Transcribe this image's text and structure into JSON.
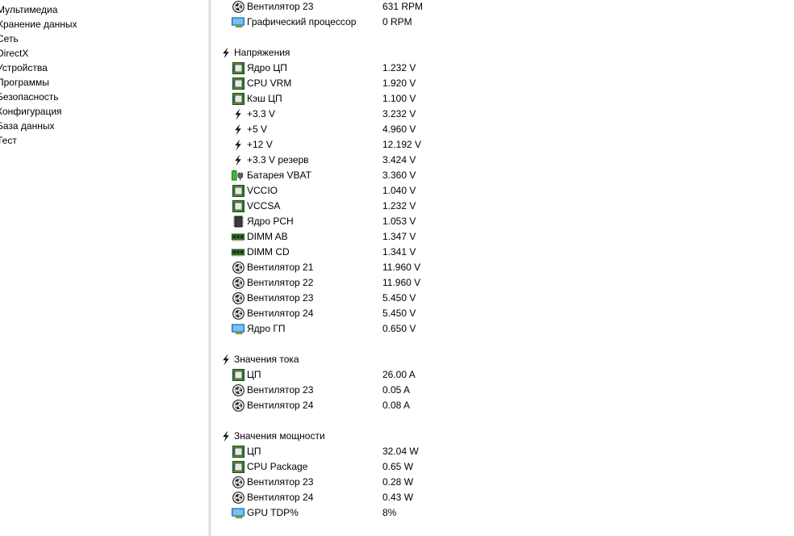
{
  "sidebar": {
    "items": [
      {
        "label": "Мультимедиа"
      },
      {
        "label": "Хранение данных"
      },
      {
        "label": "Сеть"
      },
      {
        "label": "DirectX"
      },
      {
        "label": "Устройства"
      },
      {
        "label": "Программы"
      },
      {
        "label": "Безопасность"
      },
      {
        "label": "Конфигурация"
      },
      {
        "label": "База данных"
      },
      {
        "label": "Тест"
      }
    ]
  },
  "sensors": {
    "rows": [
      {
        "kind": "item",
        "icon": "fan-icon",
        "label": "Вентилятор 23",
        "value": "631 RPM"
      },
      {
        "kind": "item",
        "icon": "gpu-icon",
        "label": "Графический процессор",
        "value": "0 RPM"
      },
      {
        "kind": "section",
        "icon": "lightning-icon",
        "label": "Напряжения"
      },
      {
        "kind": "item",
        "icon": "cpu-icon",
        "label": "Ядро ЦП",
        "value": "1.232 V"
      },
      {
        "kind": "item",
        "icon": "cpu-icon",
        "label": "CPU VRM",
        "value": "1.920 V"
      },
      {
        "kind": "item",
        "icon": "cpu-icon",
        "label": "Кэш ЦП",
        "value": "1.100 V"
      },
      {
        "kind": "item",
        "icon": "lightning-icon",
        "label": "+3.3 V",
        "value": "3.232 V"
      },
      {
        "kind": "item",
        "icon": "lightning-icon",
        "label": "+5 V",
        "value": "4.960 V"
      },
      {
        "kind": "item",
        "icon": "lightning-icon",
        "label": "+12 V",
        "value": "12.192 V"
      },
      {
        "kind": "item",
        "icon": "lightning-icon",
        "label": "+3.3 V резерв",
        "value": "3.424 V"
      },
      {
        "kind": "item",
        "icon": "battery-icon",
        "label": "Батарея VBAT",
        "value": "3.360 V"
      },
      {
        "kind": "item",
        "icon": "cpu-icon",
        "label": "VCCIO",
        "value": "1.040 V"
      },
      {
        "kind": "item",
        "icon": "cpu-icon",
        "label": "VCCSA",
        "value": "1.232 V"
      },
      {
        "kind": "item",
        "icon": "chip-icon",
        "label": "Ядро PCH",
        "value": "1.053 V"
      },
      {
        "kind": "item",
        "icon": "memory-icon",
        "label": "DIMM AB",
        "value": "1.347 V"
      },
      {
        "kind": "item",
        "icon": "memory-icon",
        "label": "DIMM CD",
        "value": "1.341 V"
      },
      {
        "kind": "item",
        "icon": "fan-icon",
        "label": "Вентилятор 21",
        "value": "11.960 V"
      },
      {
        "kind": "item",
        "icon": "fan-icon",
        "label": "Вентилятор 22",
        "value": "11.960 V"
      },
      {
        "kind": "item",
        "icon": "fan-icon",
        "label": "Вентилятор 23",
        "value": "5.450 V"
      },
      {
        "kind": "item",
        "icon": "fan-icon",
        "label": "Вентилятор 24",
        "value": "5.450 V"
      },
      {
        "kind": "item",
        "icon": "gpu-icon",
        "label": "Ядро ГП",
        "value": "0.650 V"
      },
      {
        "kind": "section",
        "icon": "lightning-icon",
        "label": "Значения тока"
      },
      {
        "kind": "item",
        "icon": "cpu-icon",
        "label": "ЦП",
        "value": "26.00 A"
      },
      {
        "kind": "item",
        "icon": "fan-icon",
        "label": "Вентилятор 23",
        "value": "0.05 A"
      },
      {
        "kind": "item",
        "icon": "fan-icon",
        "label": "Вентилятор 24",
        "value": "0.08 A"
      },
      {
        "kind": "section",
        "icon": "lightning-icon",
        "label": "Значения мощности"
      },
      {
        "kind": "item",
        "icon": "cpu-icon",
        "label": "ЦП",
        "value": "32.04 W"
      },
      {
        "kind": "item",
        "icon": "cpu-icon",
        "label": "CPU Package",
        "value": "0.65 W"
      },
      {
        "kind": "item",
        "icon": "fan-icon",
        "label": "Вентилятор 23",
        "value": "0.28 W"
      },
      {
        "kind": "item",
        "icon": "fan-icon",
        "label": "Вентилятор 24",
        "value": "0.43 W"
      },
      {
        "kind": "item",
        "icon": "gpu-icon",
        "label": "GPU TDP%",
        "value": "8%"
      }
    ]
  },
  "colors": {
    "chip_green": "#2f7a2f",
    "battery_green": "#3cb83c",
    "gpu_blue": "#2b8ad8",
    "fan_dark": "#1e1e1e"
  }
}
